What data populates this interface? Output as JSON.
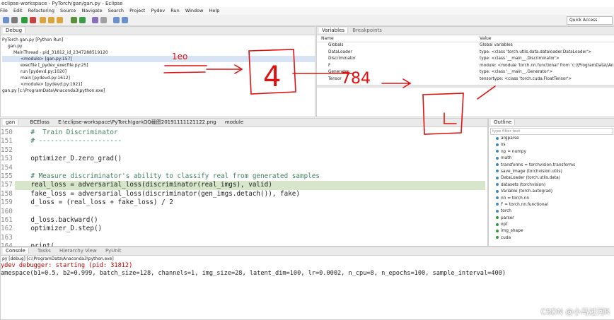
{
  "window": {
    "title": "eclipse-workspace - PyTorch/gan/gan.py - Eclipse"
  },
  "menu": [
    "File",
    "Edit",
    "Refactoring",
    "Source",
    "Navigate",
    "Search",
    "Project",
    "Pydev",
    "Run",
    "Window",
    "Help"
  ],
  "quick_access": "Quick Access",
  "debug": {
    "tab": "Debug",
    "tree": [
      "PyTorch gan.py [Python Run]",
      "gan.py",
      "MainThread - pid_31812_id_2347288519120",
      "<module> [gan.py:157]",
      "execfile [_pydev_execfile.py:25]",
      "run [pydevd.py:1020]",
      "main [pydevd.py:1612]",
      "<module> [pydevd.py:1921]",
      "gan.py [c:\\ProgramData\\Anaconda3\\python.exe]"
    ]
  },
  "variables": {
    "tabs": [
      "Variables",
      "Breakpoints"
    ],
    "col_name": "Name",
    "col_value": "Value",
    "rows": [
      {
        "name": "Globals",
        "value": "Global variables"
      },
      {
        "name": "DataLoader",
        "value": "type: <class 'torch.utils.data.dataloader.DataLoader'>"
      },
      {
        "name": "Discriminator",
        "value": "type: <class '__main__.Discriminator'>"
      },
      {
        "name": "F",
        "value": "module: <module 'torch.nn.functional' from 'c:\\\\ProgramData\\\\Anaco"
      },
      {
        "name": "Generator",
        "value": "type: <class '__main__.Generator'>"
      },
      {
        "name": "Tensor",
        "value": "tensortype: <class 'torch.cuda.FloatTensor'>"
      }
    ]
  },
  "editor": {
    "tabs": [
      "gan",
      "BCEloss",
      "E:\\eclipse-workspace\\PyTorch\\gan\\QQ截图20191111121122.png",
      "module"
    ],
    "lines": [
      {
        "num": "150",
        "text": "    #  Train Discriminator",
        "type": "comment"
      },
      {
        "num": "151",
        "text": "    # ---------------------",
        "type": "comment"
      },
      {
        "num": "152",
        "text": "",
        "type": "code"
      },
      {
        "num": "153",
        "text": "    optimizer_D.zero_grad()",
        "type": "code"
      },
      {
        "num": "154",
        "text": "",
        "type": "code"
      },
      {
        "num": "155",
        "text": "    # Measure discriminator's ability to classify real from generated samples",
        "type": "comment"
      },
      {
        "num": "157",
        "text": "    real_loss = adversarial_loss(discriminator(real_imgs), valid)",
        "type": "hl"
      },
      {
        "num": "158",
        "text": "    fake_loss = adversarial_loss(discriminator(gen_imgs.detach()), fake)",
        "type": "code"
      },
      {
        "num": "159",
        "text": "    d_loss = (real_loss + fake_loss) / 2",
        "type": "code"
      },
      {
        "num": "160",
        "text": "",
        "type": "code"
      },
      {
        "num": "161",
        "text": "    d_loss.backward()",
        "type": "code"
      },
      {
        "num": "162",
        "text": "    optimizer_D.step()",
        "type": "code"
      },
      {
        "num": "163",
        "text": "",
        "type": "code"
      },
      {
        "num": "164",
        "text": "    print(",
        "type": "code"
      }
    ]
  },
  "outline": {
    "tab": "Outline",
    "filter_placeholder": "type filter text",
    "items": [
      "argparse",
      "os",
      "np = numpy",
      "math",
      "transforms = torchvision.transforms",
      "save_image (torchvision.utils)",
      "DataLoader (torch.utils.data)",
      "datasets (torchvision)",
      "Variable (torch.autograd)",
      "nn = torch.nn",
      "F = torch.nn.functional",
      "torch",
      "parser",
      "opt",
      "img_shape",
      "cuda"
    ]
  },
  "console": {
    "tabs": [
      "Console",
      "Tasks",
      "Hierarchy View",
      "PyUnit"
    ],
    "header": "py [debug] [c:\\ProgramData\\Anaconda3\\python.exe]",
    "line1": "ydev debugger: starting (pid: 31812)",
    "line2": "amespace(b1=0.5, b2=0.999, batch_size=128, channels=1, img_size=28, latent_dim=100, lr=0.0002, n_cpu=8, n_epochs=100, sample_interval=400)"
  },
  "annotations": {
    "top_small": "1eo",
    "box_number": "4",
    "mid": "784"
  },
  "watermark": "CSDN @小马过河R",
  "colors": {
    "highlight_line": "#d7e6c8",
    "comment": "#3f7f5f",
    "console_red": "#c00000",
    "handwriting_red": "#e01010"
  }
}
